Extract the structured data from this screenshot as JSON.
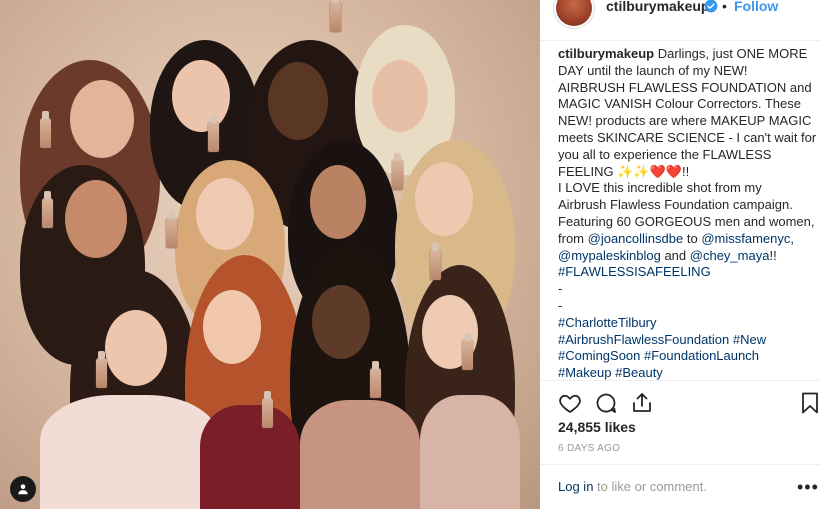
{
  "post": {
    "username": "ctilburymakeup",
    "separator": "•",
    "follow_label": "Follow",
    "caption_author": "ctilburymakeup",
    "caption_lines": [
      "Darlings, just ONE MORE",
      "DAY until the launch of my NEW!",
      "AIRBRUSH FLAWLESS FOUNDATION and",
      "MAGIC VANISH Colour Correctors. These",
      "NEW! products are where MAKEUP MAGIC",
      "meets SKINCARE SCIENCE - I can't wait for",
      "you all to experience the FLAWLESS",
      "FEELING ✨✨❤️❤️!!",
      "I LOVE this incredible shot from my",
      "Airbrush Flawless Foundation campaign.",
      "Featuring 60 GORGEOUS men and women,",
      "from",
      "@joancollinsdbe",
      "to",
      "@missfamenyc,",
      "@mypaleskinblog",
      "and",
      "@chey_maya",
      "!!",
      "#FLAWLESSISAFEELING",
      "-",
      "-",
      "#CharlotteTilbury",
      "#AirbrushFlawlessFoundation",
      "#New",
      "#ComingSoon",
      "#FoundationLaunch",
      "#Makeup",
      "#Beauty"
    ],
    "likes": "24,855 likes",
    "time_ago": "6 DAYS AGO",
    "login_link": "Log in",
    "login_rest": "to like or comment.",
    "more_label": "•••"
  },
  "icons": {
    "verified": "verified-badge-icon",
    "like": "heart-icon",
    "comment": "comment-icon",
    "share": "share-icon",
    "save": "bookmark-icon",
    "tag": "user-tag-icon"
  },
  "colors": {
    "link": "#003569",
    "follow": "#3897f0",
    "muted": "#999999",
    "text": "#262626"
  }
}
